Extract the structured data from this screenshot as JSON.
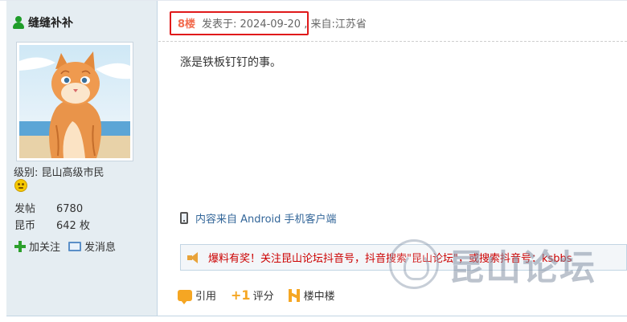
{
  "user": {
    "name": "缝缝补补",
    "level_label": "级别: 昆山高级市民",
    "stats": [
      {
        "label": "发帖",
        "value": "6780"
      },
      {
        "label": "昆币",
        "value": "642 枚"
      }
    ],
    "follow_label": "加关注",
    "message_label": "发消息"
  },
  "post": {
    "floor": "8楼",
    "posted_text": "发表于: 2024-09-20 , 来自:江苏省",
    "content": "涨是铁板钉钉的事。",
    "client_source": "内容来自 Android 手机客户端",
    "ad_text": "爆料有奖！关注昆山论坛抖音号，抖音搜索\"昆山论坛\"，或搜索抖音号：ksbbs",
    "actions": {
      "quote": "引用",
      "rate_prefix": "+1",
      "rate": "评分",
      "floor_in_floor": "楼中楼"
    }
  },
  "watermark": {
    "text": "昆山论坛"
  },
  "colors": {
    "sidebar_bg": "#e5edf2",
    "floor_highlight": "#e0191a",
    "ad_text": "#cc0000",
    "link": "#336699"
  }
}
